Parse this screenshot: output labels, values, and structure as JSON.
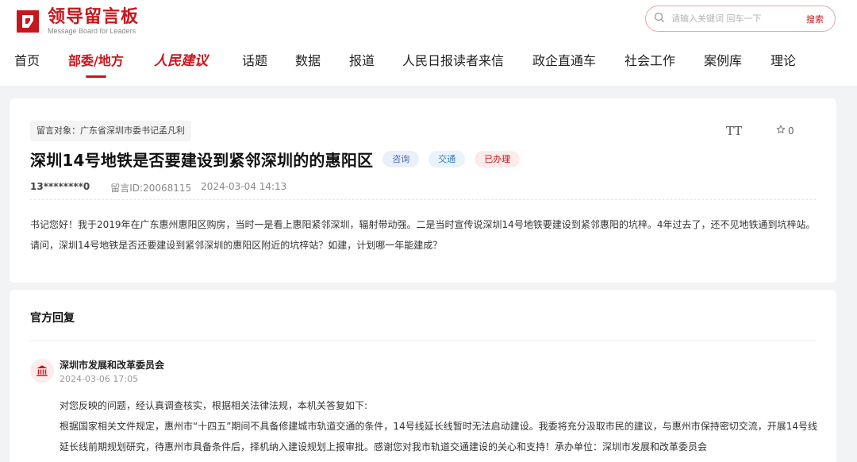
{
  "header": {
    "logo_title": "领导留言板",
    "logo_subtitle": "Message Board for Leaders",
    "search_placeholder": "请输入关键词 回车一下",
    "search_button": "搜索"
  },
  "nav": {
    "items": [
      {
        "label": "首页",
        "active": false
      },
      {
        "label": "部委/地方",
        "active": true
      },
      {
        "label": "人民建议",
        "brand": true
      },
      {
        "label": "话题",
        "active": false
      },
      {
        "label": "数据",
        "active": false
      },
      {
        "label": "报道",
        "active": false
      },
      {
        "label": "人民日报读者来信",
        "active": false
      },
      {
        "label": "政企直通车",
        "active": false
      },
      {
        "label": "社会工作",
        "active": false
      },
      {
        "label": "案例库",
        "active": false
      },
      {
        "label": "理论",
        "active": false
      }
    ]
  },
  "message": {
    "target": "留言对象：广东省深圳市委书记孟凡利",
    "font_toggle": "TT",
    "favorite_count": "0",
    "title": "深圳14号地铁是否要建设到紧邻深圳的的惠阳区",
    "tags": [
      "咨询",
      "交通",
      "已办理"
    ],
    "user": "13********0",
    "message_id": "留言ID:20068115",
    "datetime": "2024-03-04 14:13",
    "content": "书记您好！我于2019年在广东惠州惠阳区购房，当时一是看上惠阳紧邻深圳，辐射带动强。二是当时宣传说深圳14号地铁要建设到紧邻惠阳的坑梓。4年过去了，还不见地铁通到坑梓站。请问，深圳14号地铁是否还要建设到紧邻深圳的惠阳区附近的坑梓站？如建，计划哪一年能建成？"
  },
  "reply": {
    "heading": "官方回复",
    "org_name": "深圳市发展和改革委员会",
    "datetime": "2024-03-06 17:05",
    "line1": "对您反映的问题，经认真调查核实，根据相关法律法规，本机关答复如下:",
    "line2": "根据国家相关文件规定，惠州市“十四五”期间不具备修建城市轨道交通的条件，14号线延长线暂时无法启动建设。我委将充分汲取市民的建议，与惠州市保持密切交流，开展14号线延长线前期规划研究，待惠州市具备条件后，择机纳入建设规划上报审批。感谢您对我市轨道交通建设的关心和支持！承办单位：深圳市发展和改革委员会"
  },
  "colors": {
    "brand_red": "#c8161d",
    "page_bg": "#f2f3f5"
  },
  "icons": {
    "search": "search-icon",
    "star": "star-icon",
    "org": "government-building-icon"
  }
}
